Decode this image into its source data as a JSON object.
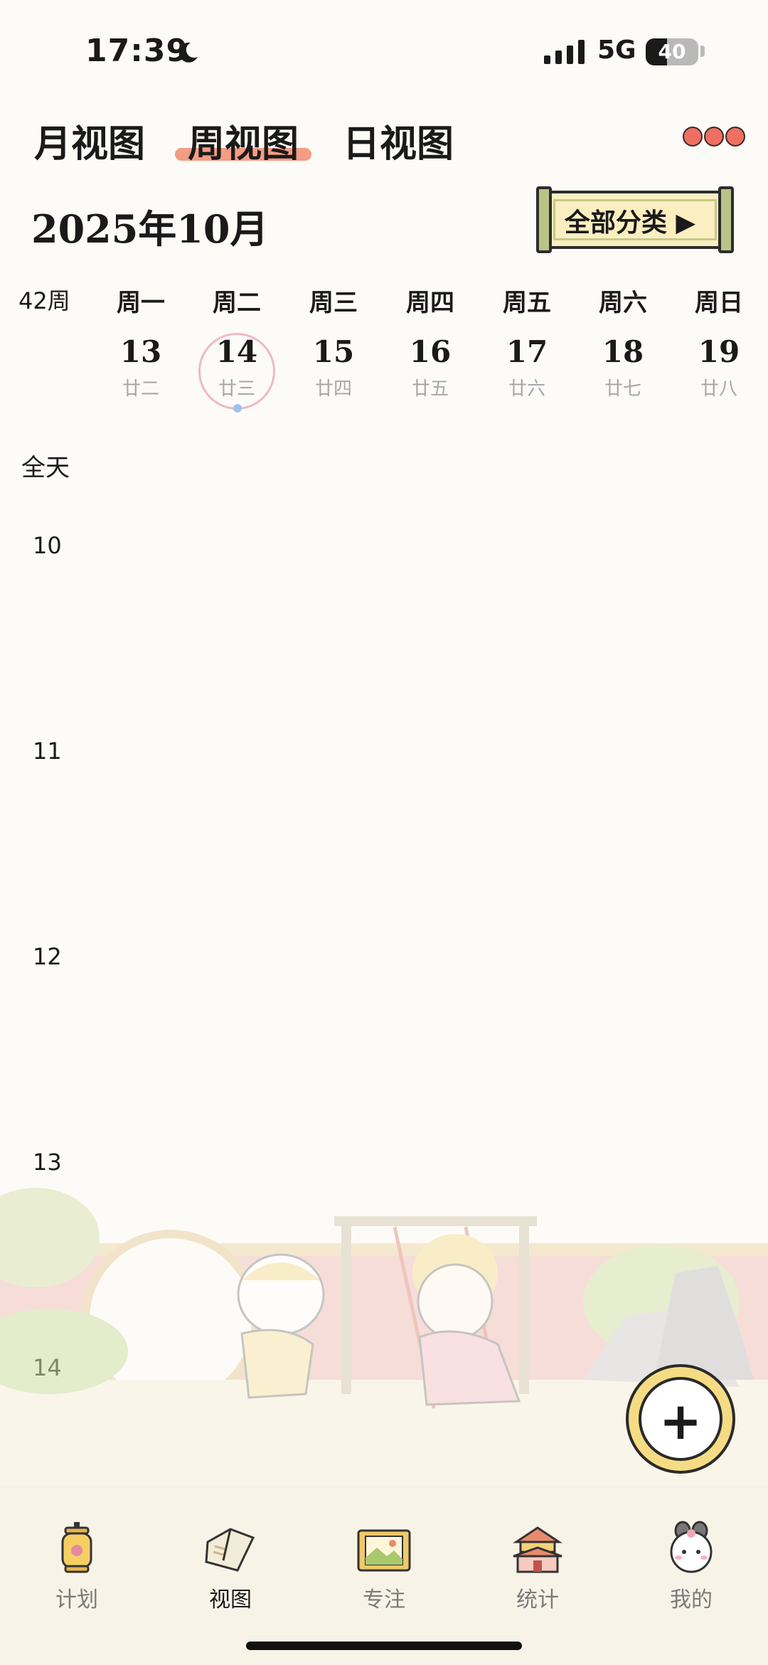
{
  "status_bar": {
    "time": "17:39",
    "network": "5G",
    "battery": "40",
    "battery_level": 0.4
  },
  "tabs": [
    {
      "label": "月视图",
      "active": false
    },
    {
      "label": "周视图",
      "active": true
    },
    {
      "label": "日视图",
      "active": false
    }
  ],
  "header": {
    "month_title": "2025年10月",
    "category_button": "全部分类 ▶"
  },
  "week": {
    "week_number": "42周",
    "days": [
      {
        "weekday": "周一",
        "date": "13",
        "lunar": "廿二"
      },
      {
        "weekday": "周二",
        "date": "14",
        "lunar": "廿三",
        "today": true
      },
      {
        "weekday": "周三",
        "date": "15",
        "lunar": "廿四"
      },
      {
        "weekday": "周四",
        "date": "16",
        "lunar": "廿五"
      },
      {
        "weekday": "周五",
        "date": "17",
        "lunar": "廿六"
      },
      {
        "weekday": "周六",
        "date": "18",
        "lunar": "廿七"
      },
      {
        "weekday": "周日",
        "date": "19",
        "lunar": "廿八"
      }
    ]
  },
  "timeline": {
    "all_day_label": "全天",
    "hours": [
      "10",
      "11",
      "12",
      "13",
      "14"
    ]
  },
  "fab": {
    "label": "+"
  },
  "bottom_nav": [
    {
      "label": "计划",
      "icon": "lantern-icon"
    },
    {
      "label": "视图",
      "icon": "book-icon",
      "active": true
    },
    {
      "label": "专注",
      "icon": "scroll-painting-icon"
    },
    {
      "label": "统计",
      "icon": "palace-icon"
    },
    {
      "label": "我的",
      "icon": "bunny-avatar-icon"
    }
  ],
  "colors": {
    "accent": "#f28b70",
    "today_ring": "#efb9c4",
    "background": "#fdfbf7",
    "tabbar": "#f7f4e7",
    "fab": "#f5dc84"
  }
}
